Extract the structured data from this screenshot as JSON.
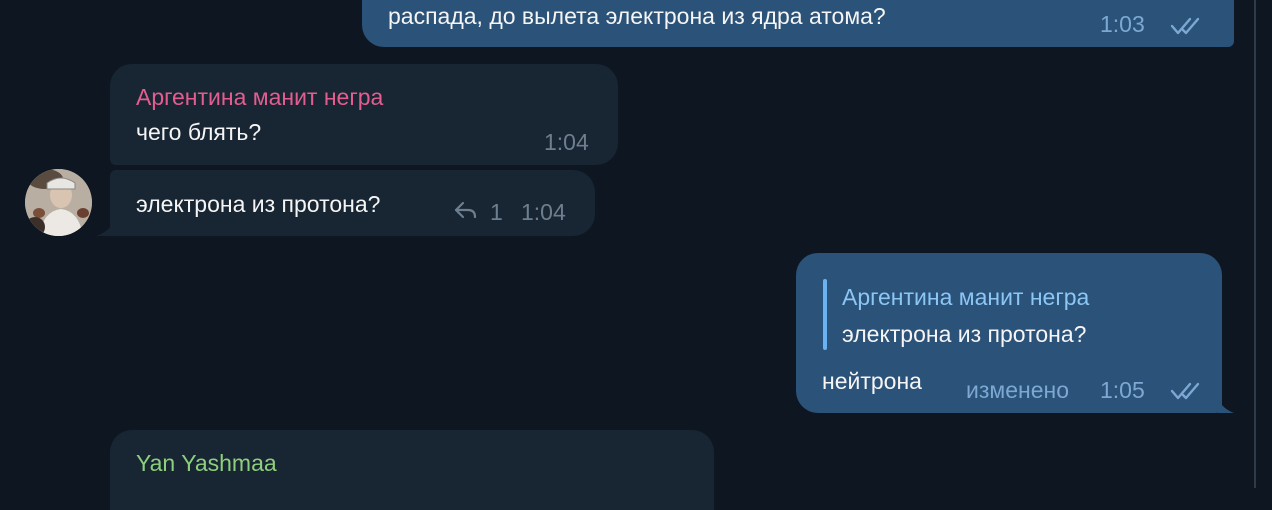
{
  "messages": [
    {
      "id": "m1",
      "direction": "out",
      "text": "распада, до вылета электрона из ядра атома?",
      "time": "1:03",
      "read": true
    },
    {
      "id": "m2",
      "direction": "in",
      "sender": "Аргентина манит негра",
      "sender_color": "#e35e8f",
      "text": "чего блять?",
      "time": "1:04"
    },
    {
      "id": "m3",
      "direction": "in",
      "text": "электрона из протона?",
      "reply_count": "1",
      "time": "1:04"
    },
    {
      "id": "m4",
      "direction": "out",
      "quote": {
        "author": "Аргентина манит негра",
        "text": "электрона из протона?"
      },
      "text": "нейтрона",
      "edited_label": "изменено",
      "time": "1:05",
      "read": true
    },
    {
      "id": "m5",
      "direction": "in",
      "sender": "Yan Yashmaa",
      "sender_color": "#8dcf7b"
    }
  ],
  "colors": {
    "background": "#0e1621",
    "incoming_bubble": "#182533",
    "outgoing_bubble": "#2b5278",
    "quote_accent": "#6ab2f2"
  },
  "icons": {
    "read_checks": "double-check-icon",
    "replies": "reply-arrow-icon",
    "avatar": "user-avatar"
  }
}
